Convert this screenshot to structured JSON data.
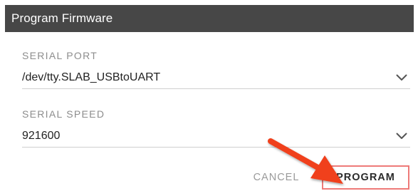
{
  "dialog": {
    "title": "Program Firmware"
  },
  "serial_port": {
    "label": "SERIAL PORT",
    "value": "/dev/tty.SLAB_USBtoUART"
  },
  "serial_speed": {
    "label": "SERIAL SPEED",
    "value": "921600"
  },
  "actions": {
    "cancel_label": "CANCEL",
    "program_label": "PROGRAM"
  },
  "colors": {
    "titlebar": "#474747",
    "annotation_arrow": "#f0411f",
    "annotation_box": "#ee7a78"
  },
  "icons": {
    "dropdown": "chevron-down-icon",
    "annotation": "arrow-icon"
  }
}
